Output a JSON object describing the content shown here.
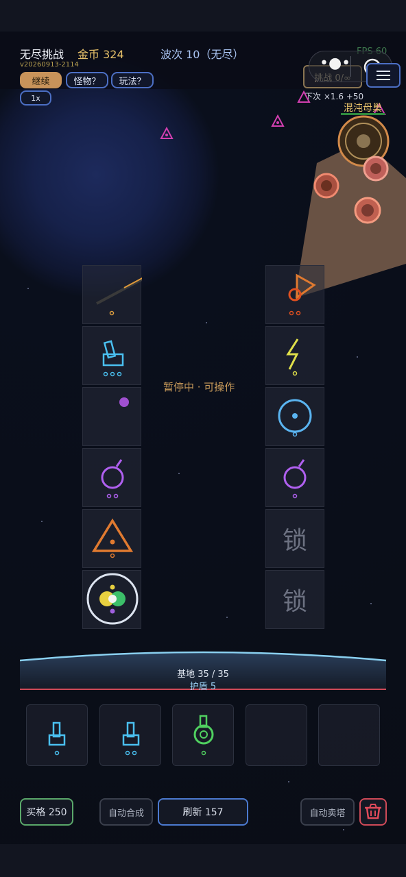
{
  "hud": {
    "mode": "无尽挑战",
    "gold": "金币 324",
    "wave": "波次 10（无尽）",
    "fps": "FPS 60",
    "version": "v20260913-2114",
    "challenge": "挑战 0/∞",
    "next": "下次 ×1.6 +50"
  },
  "controls": {
    "continue": "继续",
    "monsters": "怪物？",
    "howto": "玩法？",
    "speed": "1x"
  },
  "boss": {
    "name": "混沌母巢"
  },
  "status": {
    "paused": "暂停中 · 可操作"
  },
  "grid": {
    "lock_label_1": "锁",
    "lock_label_2": "锁"
  },
  "base": {
    "hp": "基地 35 / 35",
    "shield": "护盾 5",
    "hp_fraction": 1.0
  },
  "buttons": {
    "buy": "买格 250",
    "auto_merge": "自动合成",
    "refresh": "刷新 157",
    "auto_sell": "自动卖塔"
  },
  "colors": {
    "gold": "#e8c26a",
    "accent_blue": "#4c6fc4",
    "green": "#5aa86a",
    "red": "#d04a58"
  }
}
